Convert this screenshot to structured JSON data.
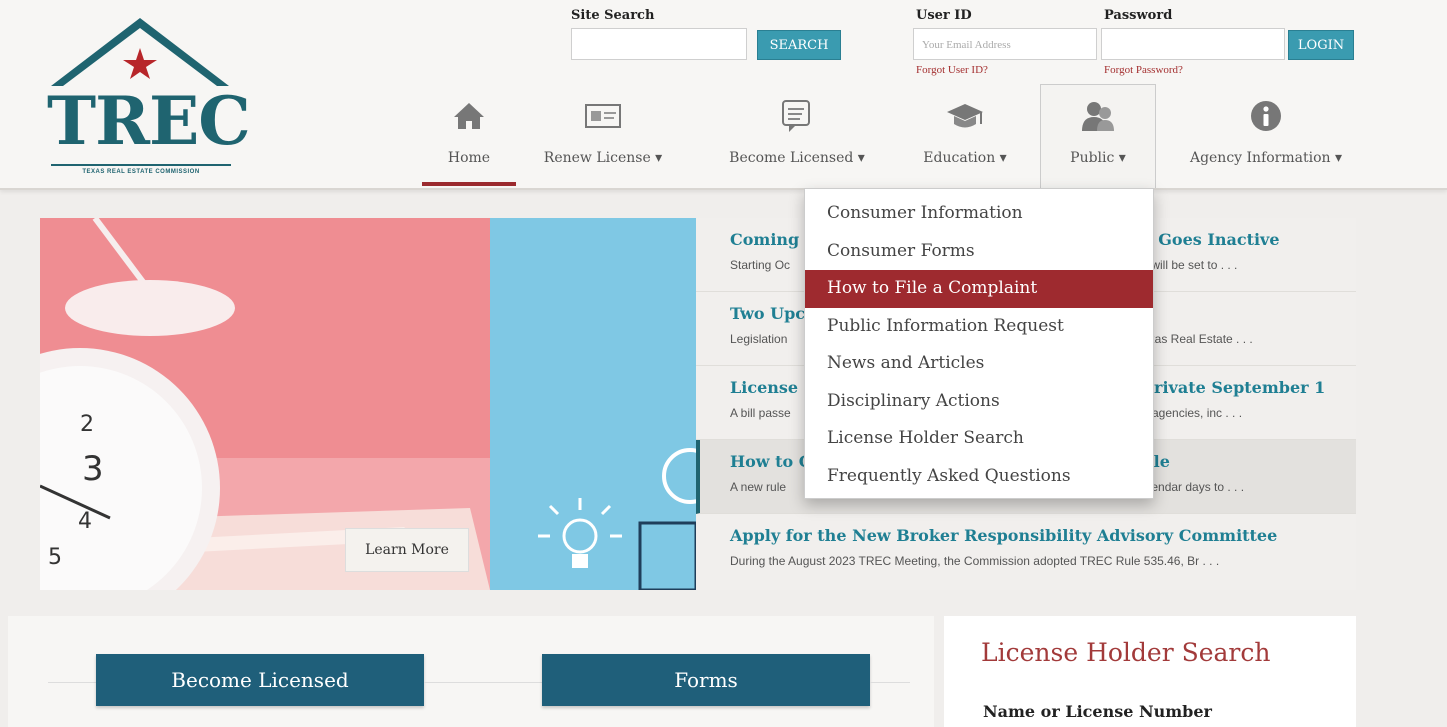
{
  "logo": {
    "name": "TREC",
    "subtitle": "TEXAS REAL ESTATE COMMISSION"
  },
  "site_search": {
    "label": "Site Search",
    "value": "",
    "button": "SEARCH"
  },
  "login": {
    "user_id_label": "User ID",
    "user_id_placeholder": "Your Email Address",
    "password_label": "Password",
    "password_value": "",
    "button": "LOGIN",
    "forgot_user_id": "Forgot User ID?",
    "forgot_password": "Forgot Password?"
  },
  "nav": {
    "items": [
      {
        "label": "Home",
        "icon": "home-icon"
      },
      {
        "label": "Renew License ▾",
        "icon": "license-card-icon"
      },
      {
        "label": "Become Licensed ▾",
        "icon": "document-icon"
      },
      {
        "label": "Education ▾",
        "icon": "graduation-cap-icon"
      },
      {
        "label": "Public ▾",
        "icon": "people-icon"
      },
      {
        "label": "Agency Information ▾",
        "icon": "info-icon"
      }
    ]
  },
  "public_menu": {
    "items": [
      "Consumer Information",
      "Consumer Forms",
      "How to File a Complaint",
      "Public Information Request",
      "News and Articles",
      "Disciplinary Actions",
      "License Holder Search",
      "Frequently Asked Questions"
    ],
    "active_index": 2
  },
  "hero": {
    "learn_more": "Learn More"
  },
  "news": [
    {
      "title": "Coming",
      "title_right": "o Goes Inactive",
      "excerpt": "Starting Oc",
      "excerpt_right": "s will be set to . . ."
    },
    {
      "title": "Two Upc",
      "title_right": "",
      "excerpt": "Legislation",
      "excerpt_right": "exas Real Estate . . ."
    },
    {
      "title": "License",
      "title_right": "Private September 1",
      "excerpt": "A bill passe",
      "excerpt_right": "g agencies, inc . . ."
    },
    {
      "title": "How to C",
      "title_right": "ule",
      "excerpt": "A new rule",
      "excerpt_right": "alendar days to . . ."
    },
    {
      "title": "Apply for the New Broker Responsibility Advisory Committee",
      "title_right": "",
      "excerpt": "During the August 2023 TREC Meeting, the Commission adopted TREC Rule 535.46, Br . . .",
      "excerpt_right": ""
    }
  ],
  "cta": {
    "become_licensed": "Become Licensed",
    "forms": "Forms"
  },
  "license_search": {
    "title": "License Holder Search",
    "field_label": "Name or License Number"
  }
}
